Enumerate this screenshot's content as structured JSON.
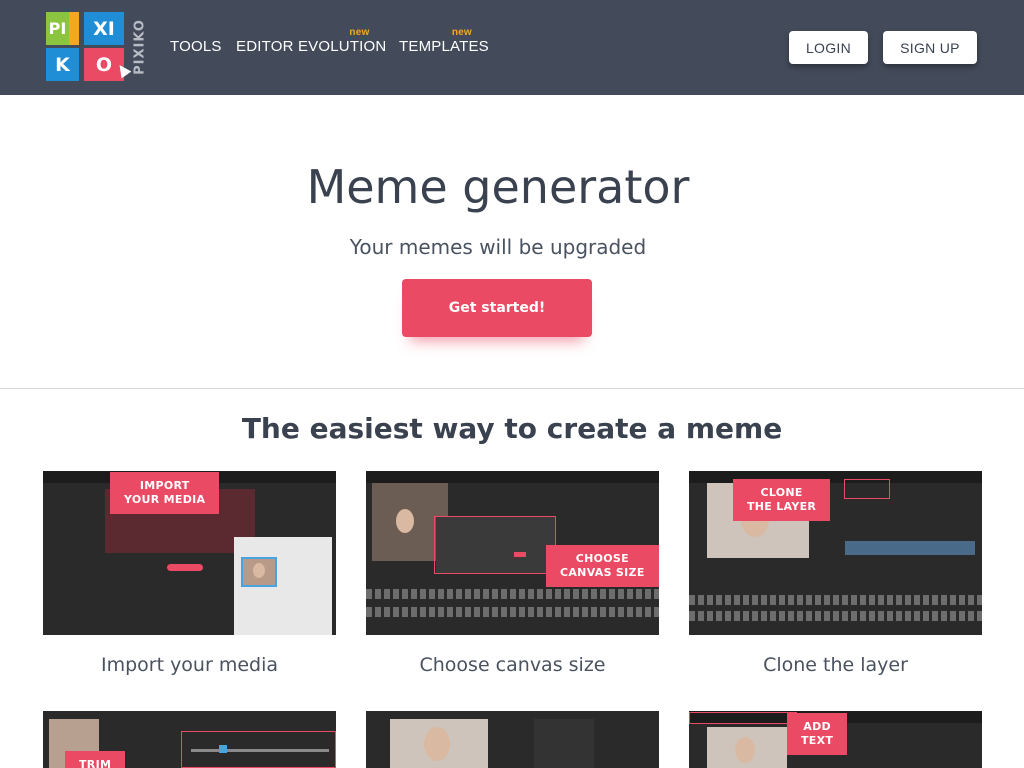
{
  "logo": {
    "row1": [
      "PI",
      "XI"
    ],
    "row2": [
      "K",
      "O"
    ],
    "vertical": "PIXIKO",
    "colors": {
      "green": "#8bc53f",
      "blue": "#1f8ed6",
      "red": "#ea4a63",
      "yellow": "#f5a623"
    }
  },
  "nav": {
    "items": [
      {
        "label": "TOOLS",
        "badge": ""
      },
      {
        "label": "EDITOR EVOLUTION",
        "badge": "new"
      },
      {
        "label": "TEMPLATES",
        "badge": "new"
      }
    ],
    "login_label": "LOGIN",
    "signup_label": "SIGN UP"
  },
  "hero": {
    "title": "Meme generator",
    "subtitle": "Your memes will be upgraded",
    "cta_label": "Get started!"
  },
  "features": {
    "title": "The easiest way to create a meme",
    "cards": [
      {
        "callout": "IMPORT\nYOUR MEDIA",
        "caption": "Import your media"
      },
      {
        "callout": "CHOOSE\nCANVAS SIZE",
        "caption": "Choose canvas size"
      },
      {
        "callout": "CLONE\nTHE LAYER",
        "caption": "Clone the layer"
      },
      {
        "callout": "TRIM",
        "caption": ""
      },
      {
        "callout": "",
        "caption": ""
      },
      {
        "callout": "ADD\nTEXT",
        "caption": ""
      }
    ]
  },
  "theme": {
    "header_bg": "#434b5a",
    "accent": "#ea4a63",
    "badge": "#f5a623"
  }
}
